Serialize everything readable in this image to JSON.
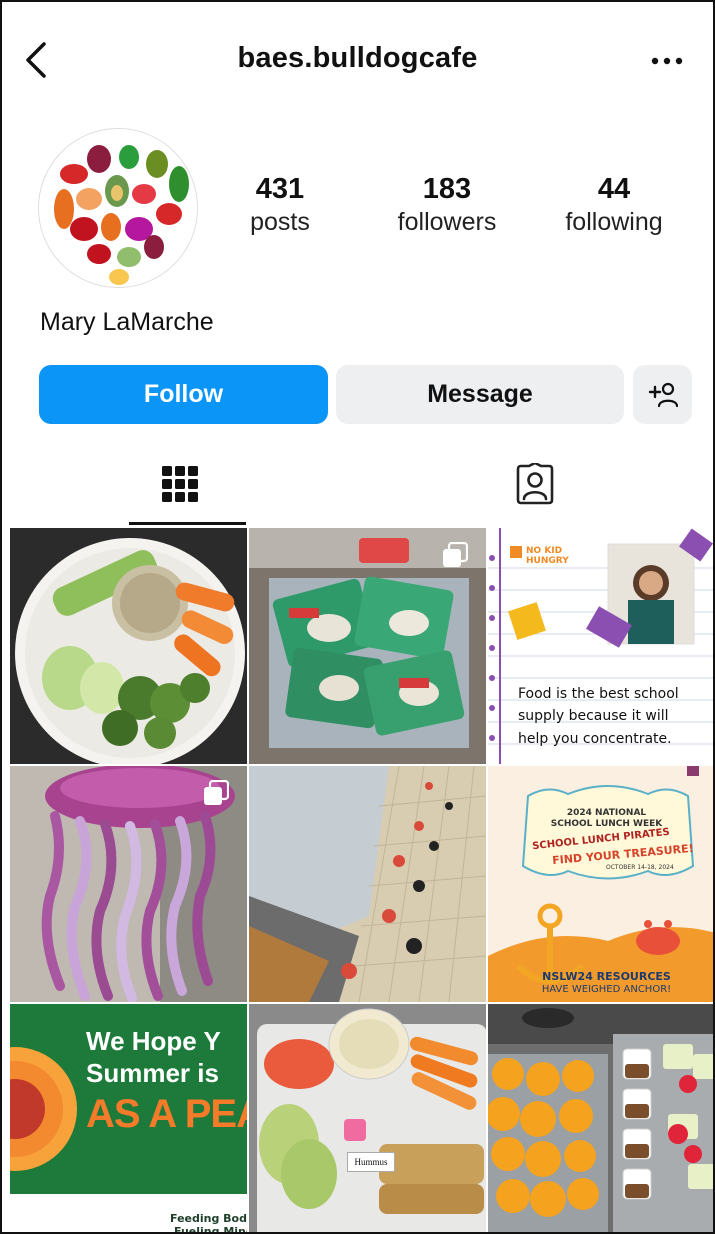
{
  "header": {
    "username": "baes.bulldogcafe",
    "back_icon": "chevron-left-icon",
    "more_icon": "more-horizontal-icon"
  },
  "profile": {
    "display_name": "Mary LaMarche",
    "stats": {
      "posts_count": "431",
      "posts_label": "posts",
      "followers_count": "183",
      "followers_label": "followers",
      "following_count": "44",
      "following_label": "following"
    }
  },
  "actions": {
    "follow_label": "Follow",
    "message_label": "Message",
    "add_user_icon": "add-person-icon"
  },
  "colors": {
    "follow_blue": "#0b95f6",
    "secondary_gray": "#eeeff1"
  },
  "posts": {
    "p3": {
      "badge": "NO KID HUNGRY",
      "line1": "Food is the best school",
      "line2": "supply because it will",
      "line3": "help you concentrate."
    },
    "p6": {
      "line1": "2024 NATIONAL",
      "line2": "SCHOOL LUNCH WEEK",
      "line3": "SCHOOL LUNCH PIRATES",
      "line4": "FIND YOUR TREASURE!",
      "line5": "OCTOBER 14-18, 2024",
      "line6": "NSLW24 RESOURCES",
      "line7": "HAVE WEIGHED ANCHOR!"
    },
    "p7": {
      "line1": "We Hope Y",
      "line2": "Summer is",
      "line3": "AS A PEA",
      "line4": "Feeding Bodie",
      "line5": "Fueling Mind"
    },
    "p8": {
      "label": "Hummus"
    }
  }
}
